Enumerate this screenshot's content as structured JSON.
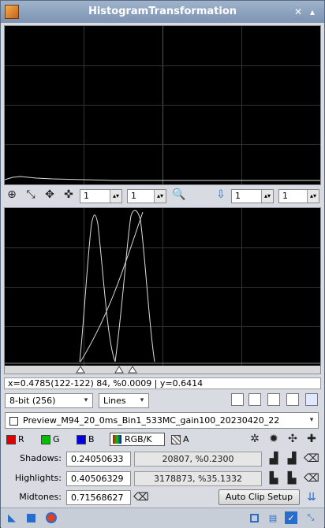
{
  "window": {
    "title": "HistogramTransformation"
  },
  "toolbar": {
    "zoom_h": "1",
    "zoom_v": "1",
    "zoom_h2": "1",
    "zoom_v2": "1"
  },
  "status": {
    "text": "x=0.4785(122-122) 84, %0.0009 | y=0.6414"
  },
  "options": {
    "bit_depth": "8-bit (256)",
    "graph_style": "Lines"
  },
  "view": {
    "selected": "Preview_M94_20_0ms_Bin1_533MC_gain100_20230420_22"
  },
  "channels": {
    "r": "R",
    "g": "G",
    "b": "B",
    "rgbk": "RGB/K",
    "a": "A",
    "colors": {
      "r": "#e00000",
      "g": "#00c000",
      "b": "#0000e0"
    }
  },
  "params": {
    "shadows_label": "Shadows:",
    "shadows_value": "0.24050633",
    "shadows_stats": "20807, %0.2300",
    "highlights_label": "Highlights:",
    "highlights_value": "0.40506329",
    "highlights_stats": "3178873, %35.1332",
    "midtones_label": "Midtones:",
    "midtones_value": "0.71568627",
    "auto_clip_label": "Auto Clip Setup"
  }
}
